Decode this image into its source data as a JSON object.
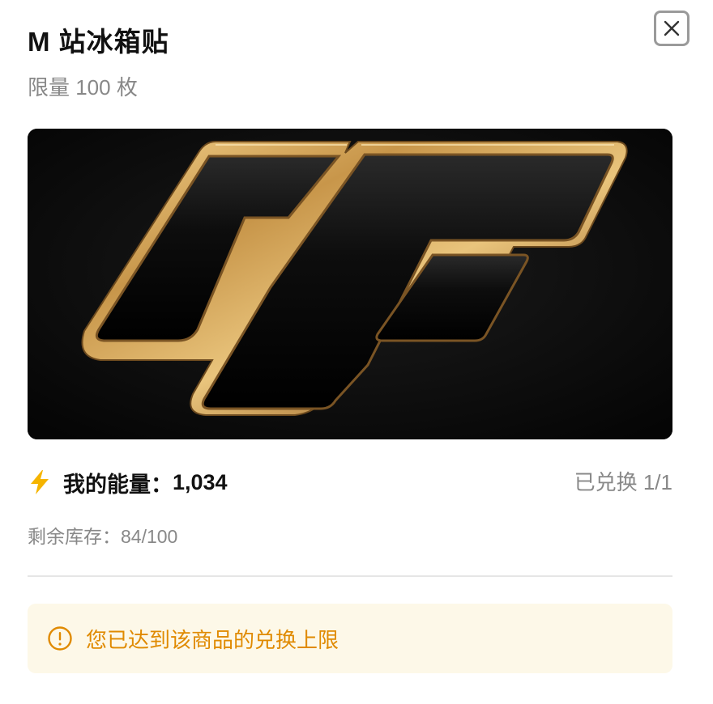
{
  "modal": {
    "title": "M 站冰箱贴",
    "subtitle": "限量 100 枚",
    "close_icon": "close-icon"
  },
  "product": {
    "image_icon": "gold-logo-magnet-image"
  },
  "energy": {
    "icon": "lightning-bolt-icon",
    "label": "我的能量：",
    "value": "1,034"
  },
  "redeem": {
    "status": "已兑换 1/1"
  },
  "stock": {
    "text": "剩余库存：84/100"
  },
  "notice": {
    "icon": "warning-circle-icon",
    "text": "您已达到该商品的兑换上限"
  },
  "colors": {
    "accent_orange": "#e08a00",
    "notice_bg": "#fdf8e8",
    "bolt_yellow": "#f5b400",
    "muted_text": "#888888"
  }
}
